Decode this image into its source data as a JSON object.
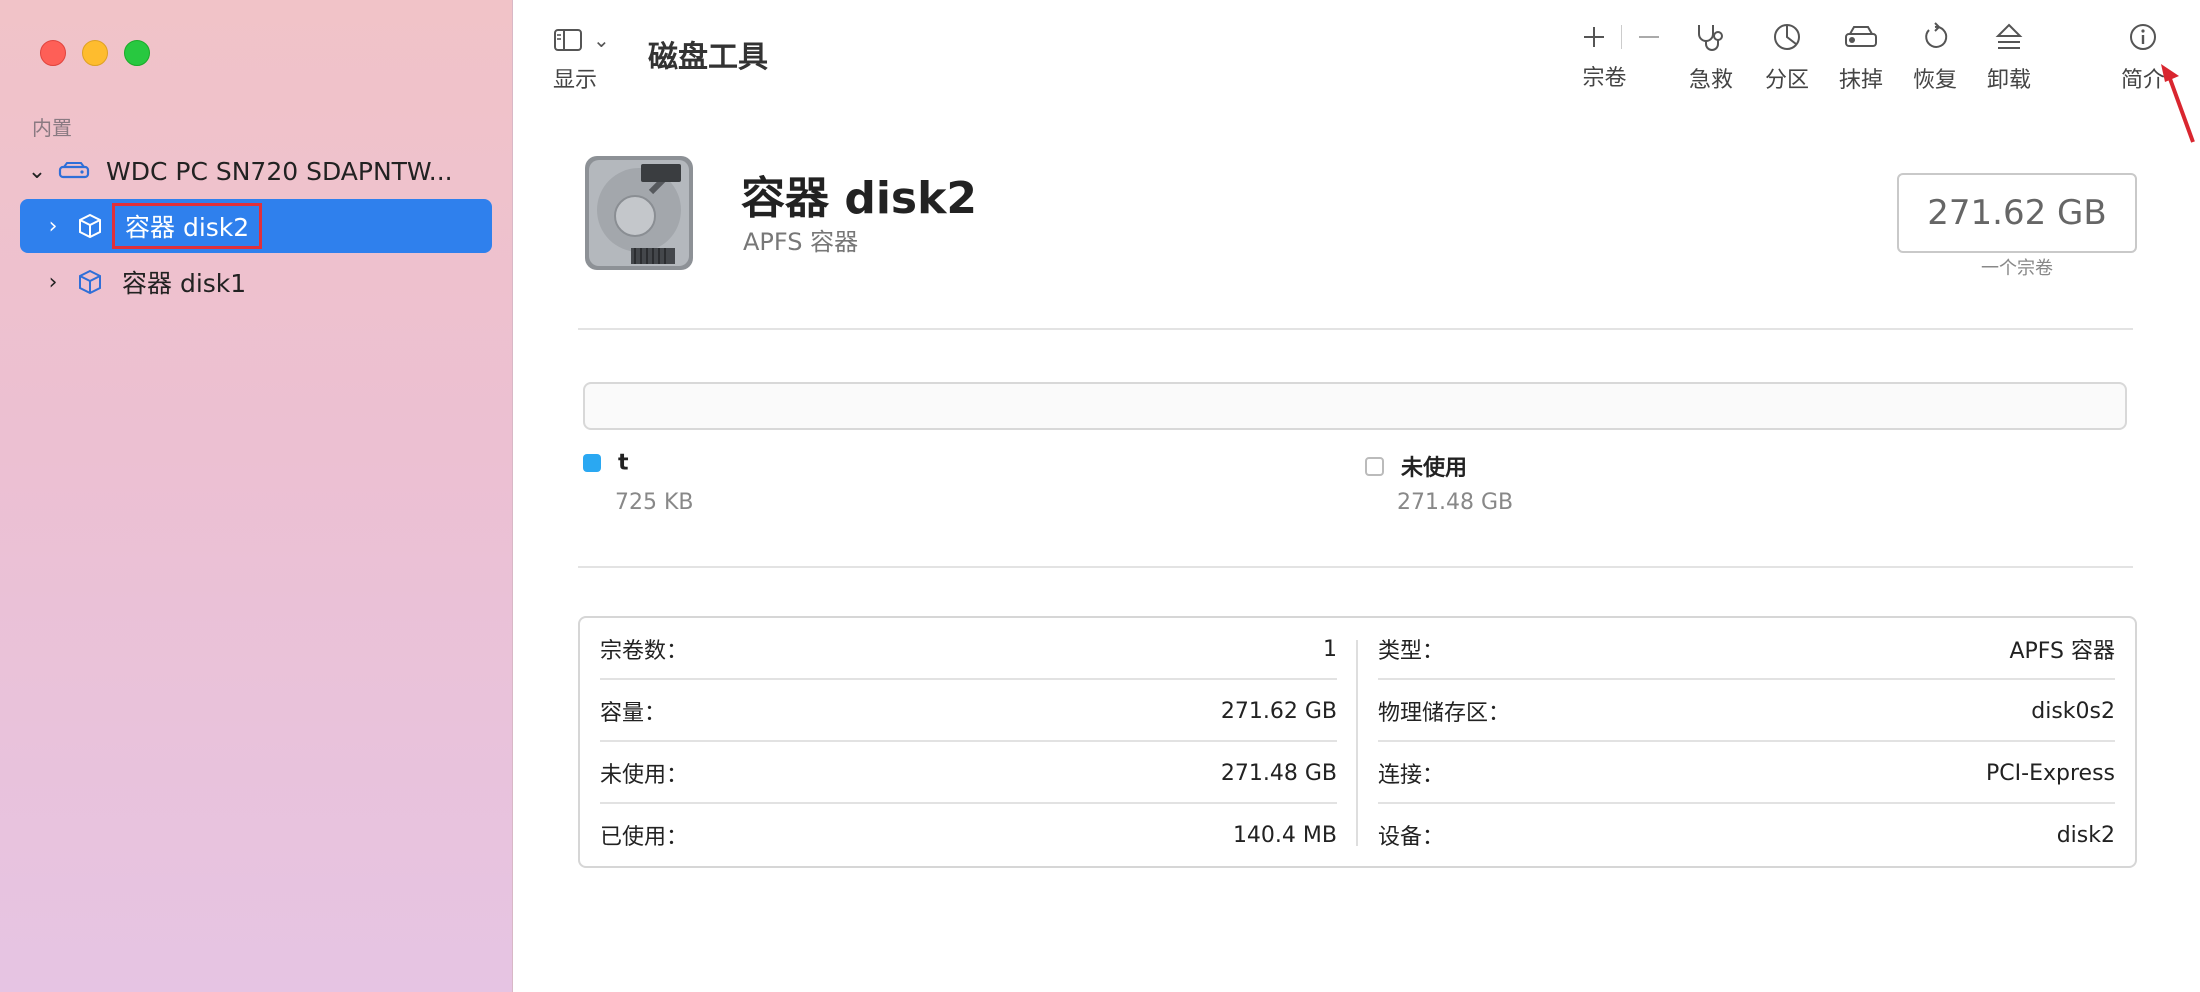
{
  "app": {
    "title": "磁盘工具",
    "view_label": "显示"
  },
  "toolbar": {
    "volume_label": "宗卷",
    "first_aid_label": "急救",
    "partition_label": "分区",
    "erase_label": "抹掉",
    "restore_label": "恢复",
    "unmount_label": "卸载",
    "info_label": "简介"
  },
  "sidebar": {
    "section": "内置",
    "disk_name": "WDC PC SN720 SDAPNTW...",
    "containers": [
      {
        "label": "容器 disk2",
        "selected": true
      },
      {
        "label": "容器 disk1",
        "selected": false
      }
    ]
  },
  "volume": {
    "name": "容器 disk2",
    "subtitle": "APFS 容器",
    "capacity": "271.62 GB",
    "capacity_caption": "一个宗卷"
  },
  "usage": [
    {
      "name": "t",
      "value": "725 KB",
      "color": "#2aa8f2"
    },
    {
      "name": "未使用",
      "value": "271.48 GB",
      "color": "#ffffff"
    }
  ],
  "info_left": [
    {
      "label": "宗卷数：",
      "value": "1"
    },
    {
      "label": "容量：",
      "value": "271.62 GB"
    },
    {
      "label": "未使用：",
      "value": "271.48 GB"
    },
    {
      "label": "已使用：",
      "value": "140.4 MB"
    }
  ],
  "info_right": [
    {
      "label": "类型：",
      "value": "APFS 容器"
    },
    {
      "label": "物理储存区：",
      "value": "disk0s2"
    },
    {
      "label": "连接：",
      "value": "PCI-Express"
    },
    {
      "label": "设备：",
      "value": "disk2"
    }
  ],
  "colors": {
    "accent": "#2f80ed",
    "highlight_box": "#e0303a",
    "arrow": "#d9262f"
  }
}
